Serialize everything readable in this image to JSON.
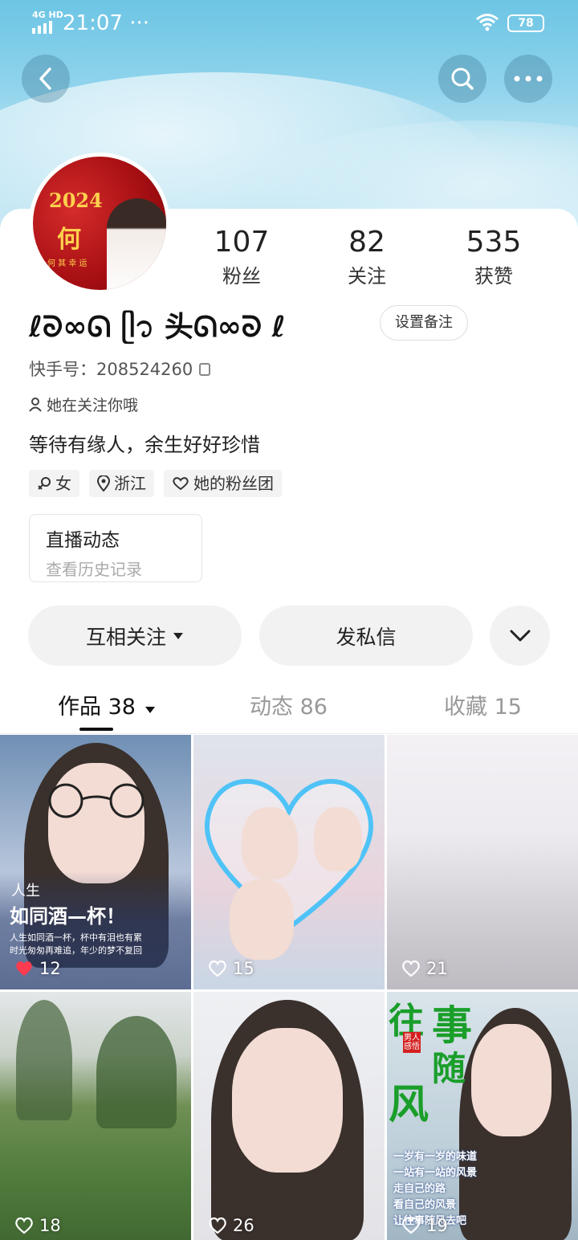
{
  "status_bar": {
    "signal": "4G HD",
    "time": "21:07",
    "dots": "···",
    "battery": "78"
  },
  "profile": {
    "nickname": "ℓ⁠ᘐ∞ᘏ ᥫ᭡ 头ᘏ∞ᘐ ℓ",
    "avatar_text_year": "2024",
    "avatar_text_name": "何",
    "avatar_text_slogan": "何 其 幸 运",
    "set_remark": "设置备注",
    "kuaishou_id": "快手号：208524260",
    "follows_you": "她在关注你哦",
    "bio": "等待有缘人，余生好好珍惜",
    "stats": [
      {
        "num": "107",
        "label": "粉丝"
      },
      {
        "num": "82",
        "label": "关注"
      },
      {
        "num": "535",
        "label": "获赞"
      }
    ],
    "tags": [
      {
        "icon": "female-icon",
        "label": "女"
      },
      {
        "icon": "location-icon",
        "label": "浙江"
      },
      {
        "icon": "fan-group-icon",
        "label": "她的粉丝团"
      }
    ],
    "live": {
      "title": "直播动态",
      "subtitle": "查看历史记录"
    }
  },
  "actions": {
    "mutual_follow": "互相关注",
    "message": "发私信"
  },
  "tabs": [
    {
      "label": "作品 38"
    },
    {
      "label": "动态 86"
    },
    {
      "label": "收藏 15"
    }
  ],
  "works": [
    {
      "likes": "12",
      "caption_line1": "人生",
      "caption_line2": "如同酒—杯！",
      "caption_line3": "人生如同酒一杯，杯中有泪也有累",
      "caption_line4": "时光匆匆再难追，年少的梦不复回"
    },
    {
      "likes": "15"
    },
    {
      "likes": "21"
    },
    {
      "likes": "18"
    },
    {
      "likes": "26"
    },
    {
      "likes": "19",
      "caption_big1": "往",
      "caption_big2": "事",
      "caption_big3": "随",
      "caption_big4": "风",
      "caption_tag": "男人感悟",
      "caption_line1": "一岁有一岁的味道",
      "caption_line2": "一站有一站的风景",
      "caption_line3": "走自己的路",
      "caption_line4": "看自己的风景",
      "caption_line5": "让往事随风去吧"
    }
  ],
  "colors": {
    "banner": "#8fd3ec",
    "avatar_bg": "#a40e12",
    "heart_red": "#ff3b4f"
  }
}
